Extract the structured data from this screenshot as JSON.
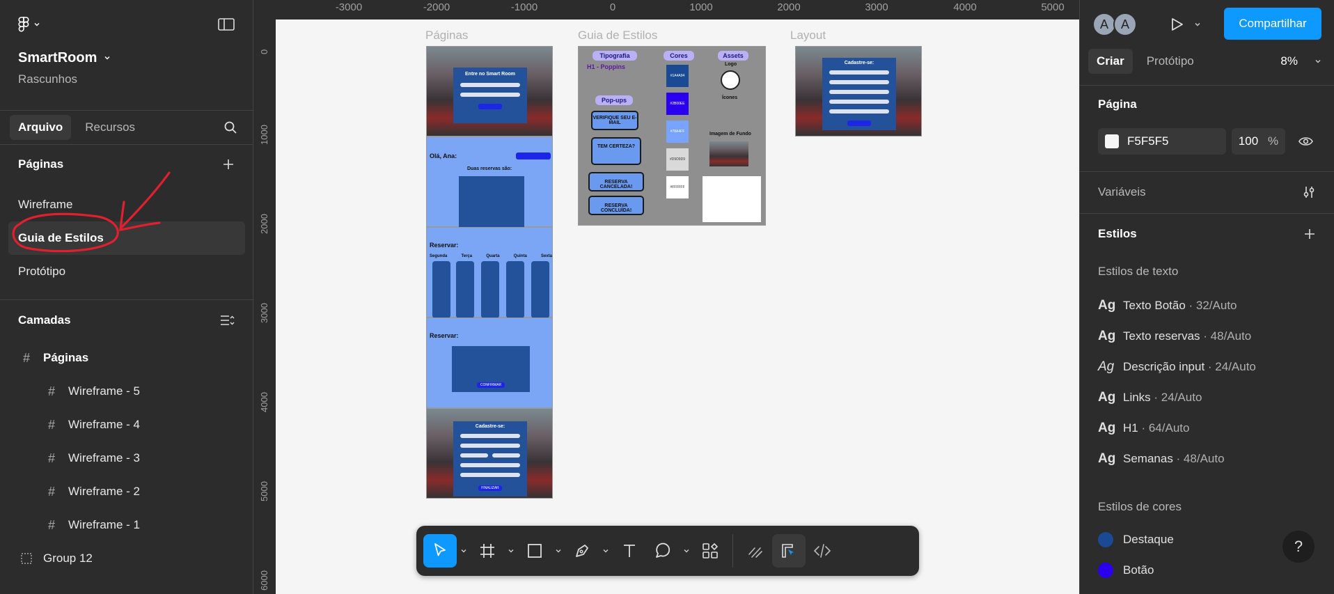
{
  "left_panel": {
    "project_name": "SmartRoom",
    "project_sub": "Rascunhos",
    "tabs": [
      "Arquivo",
      "Recursos"
    ],
    "pages_header": "Páginas",
    "pages": [
      "Wireframe",
      "Guia de Estilos",
      "Protótipo"
    ],
    "layers_header": "Camadas",
    "layers": [
      {
        "name": "Páginas",
        "icon": "frame-icon",
        "indent": 0
      },
      {
        "name": "Wireframe - 5",
        "icon": "frame-icon",
        "indent": 1
      },
      {
        "name": "Wireframe - 4",
        "icon": "frame-icon",
        "indent": 1
      },
      {
        "name": "Wireframe - 3",
        "icon": "frame-icon",
        "indent": 1
      },
      {
        "name": "Wireframe - 2",
        "icon": "frame-icon",
        "indent": 1
      },
      {
        "name": "Wireframe - 1",
        "icon": "frame-icon",
        "indent": 1
      },
      {
        "name": "Group 12",
        "icon": "group-icon",
        "indent": 0
      }
    ]
  },
  "canvas": {
    "ruler_top": [
      "-3000",
      "-2000",
      "-1000",
      "0",
      "1000",
      "2000",
      "3000",
      "4000",
      "5000"
    ],
    "ruler_left": [
      "0",
      "1000",
      "2000",
      "3000",
      "4000",
      "5000",
      "6000"
    ],
    "frame_labels": {
      "paginas": "Páginas",
      "guia": "Guia de Estilos",
      "layout": "Layout"
    },
    "wireframe_texts": {
      "login_title": "Entre no Smart Room",
      "hello": "Olá, Ana:",
      "reservations": "Duas reservas são:",
      "reserve": "Reservar:",
      "days": [
        "Segunda",
        "Terça",
        "Quarta",
        "Quinta",
        "Sexta"
      ],
      "confirm": "CONFIRMAR",
      "signup": "Cadastre-se:",
      "finish": "FINALIZAR"
    },
    "style_guide": {
      "typography": "Tipografia",
      "colors": "Cores",
      "assets": "Assets",
      "h1": "H1 - Poppins",
      "popups": "Pop-ups",
      "popup_items": [
        "VERIFIQUE SEU E-MAIL",
        "TEM CERTEZA?",
        "RESERVA CANCELADA!",
        "RESERVA CONCLUÍDA!"
      ],
      "swatches": [
        "#1A4A94",
        "#2B00EE",
        "#78A4FF",
        "#D9D9D9",
        "#FFFFFF"
      ],
      "logo": "Logo",
      "icons": "Ícones",
      "bg": "Imagem de Fundo"
    }
  },
  "toolbar": {
    "tools": [
      "move-tool",
      "frame-tool",
      "shape-tool",
      "pen-tool",
      "text-tool",
      "comment-tool",
      "components-tool"
    ],
    "right_tools": [
      "draw-mode",
      "design-mode",
      "dev-mode"
    ]
  },
  "right_panel": {
    "avatars": [
      "A",
      "A"
    ],
    "share": "Compartilhar",
    "tabs": [
      "Criar",
      "Protótipo"
    ],
    "zoom": "8%",
    "page_header": "Página",
    "page_color": "F5F5F5",
    "page_opacity": "100",
    "percent": "%",
    "variables": "Variáveis",
    "styles": "Estilos",
    "text_styles_header": "Estilos de texto",
    "text_styles": [
      {
        "glyph": "Ag",
        "name": "Texto Botão",
        "spec": " · 32/Auto",
        "italic": false
      },
      {
        "glyph": "Ag",
        "name": "Texto reservas",
        "spec": " · 48/Auto",
        "italic": false
      },
      {
        "glyph": "Ag",
        "name": "Descrição input",
        "spec": " · 24/Auto",
        "italic": true
      },
      {
        "glyph": "Ag",
        "name": "Links",
        "spec": " · 24/Auto",
        "italic": false
      },
      {
        "glyph": "Ag",
        "name": "H1",
        "spec": " · 64/Auto",
        "italic": false
      },
      {
        "glyph": "Ag",
        "name": "Semanas",
        "spec": " · 48/Auto",
        "italic": false
      }
    ],
    "color_styles_header": "Estilos de cores",
    "color_styles": [
      {
        "name": "Destaque",
        "color": "#1a4a94"
      },
      {
        "name": "Botão",
        "color": "#2b00ee"
      }
    ],
    "help": "?"
  },
  "colors": {
    "accent": "#0d99ff",
    "annotation": "#e0202f"
  }
}
